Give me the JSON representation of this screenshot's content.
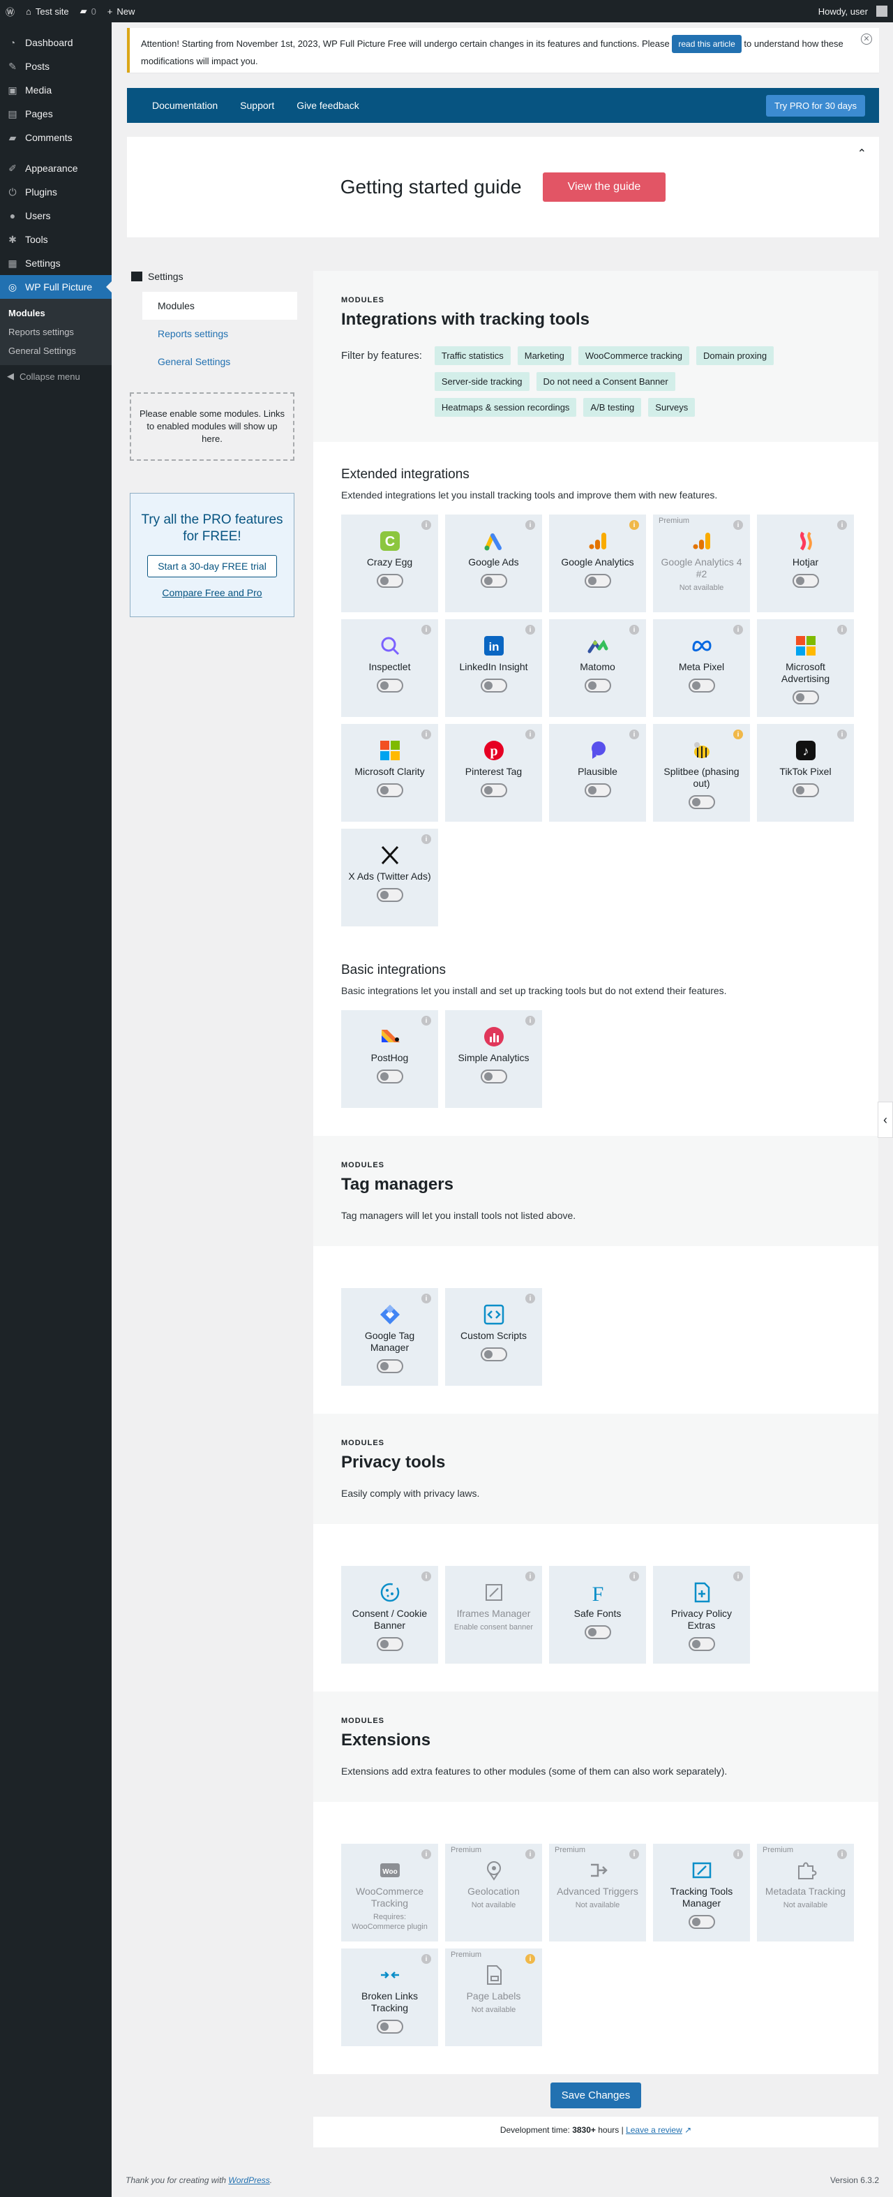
{
  "adminbar": {
    "site_name": "Test site",
    "comments_count": "0",
    "new_label": "New",
    "howdy": "Howdy, user"
  },
  "sidebar": {
    "items": [
      {
        "label": "Dashboard",
        "icon": "dashboard-icon"
      },
      {
        "label": "Posts",
        "icon": "pin-icon"
      },
      {
        "label": "Media",
        "icon": "media-icon"
      },
      {
        "label": "Pages",
        "icon": "page-icon"
      },
      {
        "label": "Comments",
        "icon": "comment-icon"
      },
      {
        "label": "Appearance",
        "icon": "brush-icon"
      },
      {
        "label": "Plugins",
        "icon": "plug-icon"
      },
      {
        "label": "Users",
        "icon": "user-icon"
      },
      {
        "label": "Tools",
        "icon": "wrench-icon"
      },
      {
        "label": "Settings",
        "icon": "settings-icon"
      },
      {
        "label": "WP Full Picture",
        "icon": "wpfp-icon"
      }
    ],
    "submenu": [
      "Modules",
      "Reports settings",
      "General Settings"
    ],
    "collapse": "Collapse menu"
  },
  "notice": {
    "text_before": "Attention! Starting from November 1st, 2023, WP Full Picture Free will undergo certain changes in its features and functions. Please",
    "button": "read this article",
    "text_after": "to understand how these modifications will impact you."
  },
  "topnav": {
    "links": [
      "Documentation",
      "Support",
      "Give feedback"
    ],
    "pro_button": "Try PRO for 30 days"
  },
  "guide": {
    "title": "Getting started guide",
    "button": "View the guide"
  },
  "side": {
    "heading": "Settings",
    "items": [
      "Modules",
      "Reports settings",
      "General Settings"
    ],
    "empty_text": "Please enable some modules. Links to enabled modules will show up here.",
    "pro_title": "Try all the PRO features for FREE!",
    "pro_button": "Start a 30-day FREE trial",
    "pro_link": "Compare Free and Pro"
  },
  "tracking": {
    "eyebrow": "MODULES",
    "title": "Integrations with tracking tools",
    "filter_label": "Filter by features:",
    "tags": [
      "Traffic statistics",
      "Marketing",
      "WooCommerce tracking",
      "Domain proxing",
      "Server-side tracking",
      "Do not need a Consent Banner",
      "Heatmaps & session recordings",
      "A/B testing",
      "Surveys"
    ],
    "extended": {
      "title": "Extended integrations",
      "desc": "Extended integrations let you install tracking tools and improve them with new features.",
      "cards": [
        {
          "name": "Crazy Egg",
          "icon": "crazy-egg-icon"
        },
        {
          "name": "Google Ads",
          "icon": "google-ads-icon"
        },
        {
          "name": "Google Analytics",
          "icon": "google-analytics-icon"
        },
        {
          "name": "Google Analytics 4 #2",
          "icon": "google-analytics-icon",
          "premium": "Premium",
          "note": "Not available"
        },
        {
          "name": "Hotjar",
          "icon": "hotjar-icon"
        },
        {
          "name": "Inspectlet",
          "icon": "inspectlet-icon"
        },
        {
          "name": "LinkedIn Insight",
          "icon": "linkedin-icon"
        },
        {
          "name": "Matomo",
          "icon": "matomo-icon"
        },
        {
          "name": "Meta Pixel",
          "icon": "meta-icon"
        },
        {
          "name": "Microsoft Advertising",
          "icon": "microsoft-icon"
        },
        {
          "name": "Microsoft Clarity",
          "icon": "microsoft-icon"
        },
        {
          "name": "Pinterest Tag",
          "icon": "pinterest-icon"
        },
        {
          "name": "Plausible",
          "icon": "plausible-icon"
        },
        {
          "name": "Splitbee (phasing out)",
          "icon": "splitbee-icon"
        },
        {
          "name": "TikTok Pixel",
          "icon": "tiktok-icon"
        },
        {
          "name": "X Ads (Twitter Ads)",
          "icon": "x-icon"
        }
      ]
    },
    "basic": {
      "title": "Basic integrations",
      "desc": "Basic integrations let you install and set up tracking tools but do not extend their features.",
      "cards": [
        {
          "name": "PostHog",
          "icon": "posthog-icon"
        },
        {
          "name": "Simple Analytics",
          "icon": "simple-analytics-icon"
        }
      ]
    }
  },
  "tagmanagers": {
    "eyebrow": "MODULES",
    "title": "Tag managers",
    "desc": "Tag managers will let you install tools not listed above.",
    "cards": [
      {
        "name": "Google Tag Manager",
        "icon": "gtm-icon"
      },
      {
        "name": "Custom Scripts",
        "icon": "code-icon"
      }
    ]
  },
  "privacy": {
    "eyebrow": "MODULES",
    "title": "Privacy tools",
    "desc": "Easily comply with privacy laws.",
    "cards": [
      {
        "name": "Consent / Cookie Banner",
        "icon": "cookie-icon"
      },
      {
        "name": "Iframes Manager",
        "icon": "iframe-icon",
        "note": "Enable consent banner"
      },
      {
        "name": "Safe Fonts",
        "icon": "font-icon"
      },
      {
        "name": "Privacy Policy Extras",
        "icon": "document-plus-icon"
      }
    ]
  },
  "extensions": {
    "eyebrow": "MODULES",
    "title": "Extensions",
    "desc": "Extensions add extra features to other modules (some of them can also work separately).",
    "cards": [
      {
        "name": "WooCommerce Tracking",
        "icon": "woo-icon",
        "note": "Requires: WooCommerce plugin"
      },
      {
        "name": "Geolocation",
        "icon": "location-icon",
        "premium": "Premium",
        "note": "Not available"
      },
      {
        "name": "Advanced Triggers",
        "icon": "trigger-icon",
        "premium": "Premium",
        "note": "Not available"
      },
      {
        "name": "Tracking Tools Manager",
        "icon": "tools-manager-icon"
      },
      {
        "name": "Metadata Tracking",
        "icon": "puzzle-icon",
        "premium": "Premium",
        "note": "Not available"
      },
      {
        "name": "Broken Links Tracking",
        "icon": "broken-link-icon"
      },
      {
        "name": "Page Labels",
        "icon": "page-label-icon",
        "premium": "Premium",
        "note": "Not available"
      }
    ]
  },
  "save_button": "Save Changes",
  "devtime": {
    "label": "Development time:",
    "hours": "3830+",
    "unit": "hours |",
    "review": "Leave a review"
  },
  "footer": {
    "thanks": "Thank you for creating with",
    "wp": "WordPress",
    "version": "Version 6.3.2"
  }
}
